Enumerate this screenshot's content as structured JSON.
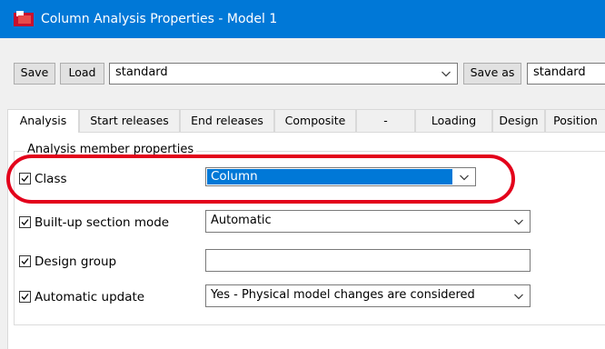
{
  "window": {
    "title": "Column Analysis Properties - Model 1"
  },
  "toolbar": {
    "save_label": "Save",
    "load_label": "Load",
    "preset_value": "standard",
    "save_as_label": "Save as",
    "save_as_value": "standard"
  },
  "tabs": [
    {
      "label": "Analysis",
      "active": true
    },
    {
      "label": "Start releases"
    },
    {
      "label": "End releases"
    },
    {
      "label": "Composite"
    },
    {
      "label": "-"
    },
    {
      "label": "Loading"
    },
    {
      "label": "Design"
    },
    {
      "label": "Position"
    }
  ],
  "group": {
    "label": "Analysis member properties"
  },
  "properties": {
    "class": {
      "label": "Class",
      "checked": true,
      "value": "Column"
    },
    "built_up": {
      "label": "Built-up section mode",
      "checked": true,
      "value": "Automatic"
    },
    "design_group": {
      "label": "Design group",
      "checked": true,
      "value": ""
    },
    "auto_update": {
      "label": "Automatic update",
      "checked": true,
      "value": "Yes - Physical model changes are considered"
    }
  },
  "colors": {
    "titlebar": "#0078d7",
    "selection": "#0078d7",
    "annotation": "#e3001b"
  }
}
